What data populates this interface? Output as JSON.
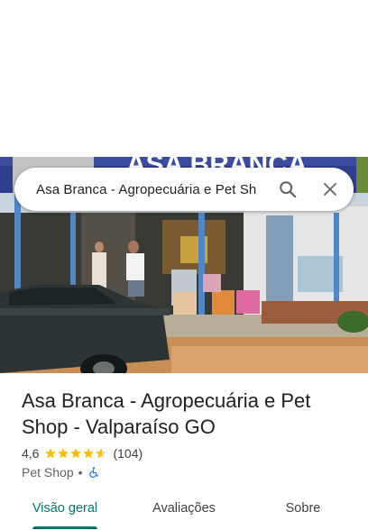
{
  "search": {
    "query": "Asa Branca - Agropecuária e Pet Sh",
    "search_icon": "search-icon",
    "close_icon": "close-icon"
  },
  "photo": {
    "storefront_sign_text": "ASA BRANCA"
  },
  "place": {
    "title": "Asa Branca - Agropecuária e Pet Shop - Valparaíso GO",
    "rating": "4,6",
    "stars": 4.6,
    "reviews": "(104)",
    "category": "Pet Shop",
    "separator": "•",
    "accessibility_icon": "wheelchair-icon"
  },
  "tabs": [
    {
      "label": "Visão geral",
      "active": true
    },
    {
      "label": "Avaliações",
      "active": false
    },
    {
      "label": "Sobre",
      "active": false
    }
  ],
  "colors": {
    "accent": "#00796b",
    "star": "#fbbc04",
    "wheelchair": "#1a73e8"
  }
}
